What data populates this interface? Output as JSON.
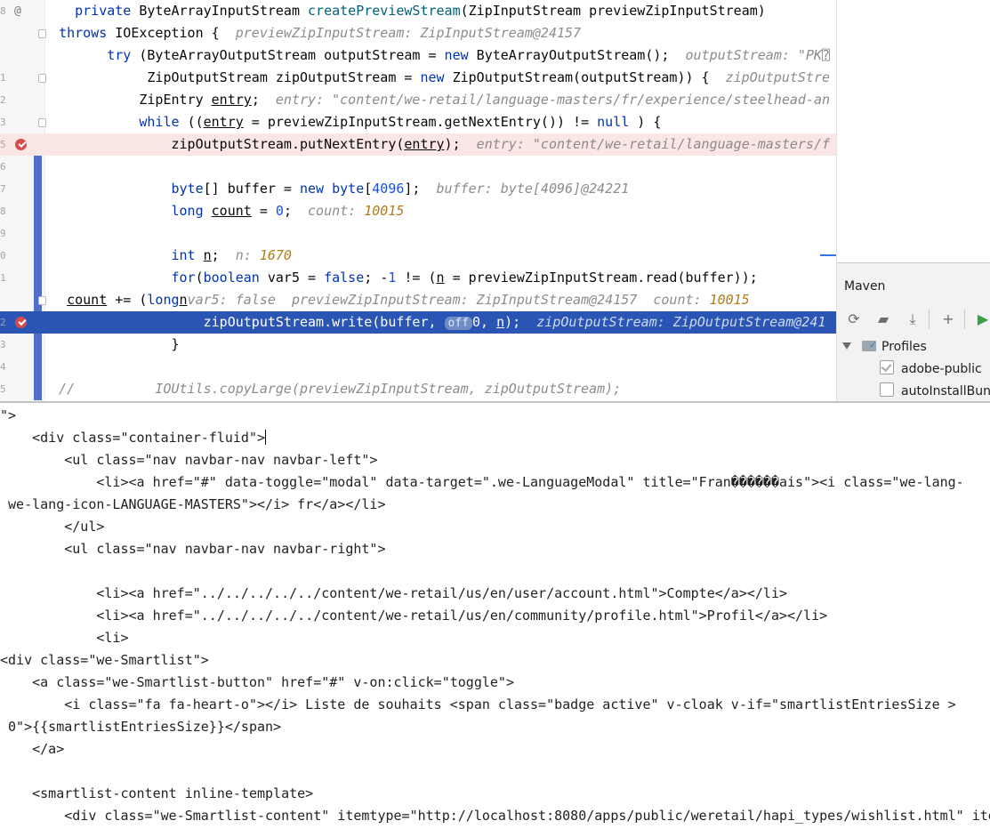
{
  "editor": {
    "lines": [
      {
        "id": "l0",
        "gutter": "8",
        "gutter_icon": "at-icon",
        "parts": [
          [
            "",
            "    "
          ],
          [
            "kw",
            "private "
          ],
          [
            "",
            "ByteArrayInputStream "
          ],
          [
            "fn",
            "createPreviewStream"
          ],
          [
            "",
            "(ZipInputStream previewZipInputStream)"
          ]
        ]
      },
      {
        "id": "l1",
        "gutter": "",
        "fold": true,
        "parts": [
          [
            "",
            "  "
          ],
          [
            "kw",
            "throws "
          ],
          [
            "",
            "IOException {  "
          ],
          [
            "hint",
            "previewZipInputStream: ZipInputStream@24157"
          ]
        ]
      },
      {
        "id": "l2",
        "gutter": "",
        "parts": [
          [
            "",
            "        "
          ],
          [
            "kw",
            "try "
          ],
          [
            "",
            "(ByteArrayOutputStream outputStream = "
          ],
          [
            "kw",
            "new "
          ],
          [
            "",
            "ByteArrayOutputStream();  "
          ],
          [
            "hint",
            "outputStream: "
          ],
          [
            "hint hstr",
            "\"PK⍰"
          ]
        ]
      },
      {
        "id": "l3",
        "gutter": "1",
        "fold": true,
        "parts": [
          [
            "",
            "             ZipOutputStream zipOutputStream = "
          ],
          [
            "kw",
            "new "
          ],
          [
            "",
            "ZipOutputStream(outputStream)) {  "
          ],
          [
            "hint",
            "zipOutputStre"
          ]
        ]
      },
      {
        "id": "l4",
        "gutter": "2",
        "parts": [
          [
            "",
            "            ZipEntry "
          ],
          [
            "ul",
            "entry"
          ],
          [
            "",
            ";  "
          ],
          [
            "hint",
            "entry: "
          ],
          [
            "hint hstr",
            "\"content/we-retail/language-masters/fr/experience/steelhead-an"
          ]
        ]
      },
      {
        "id": "l5",
        "gutter": "3",
        "fold": true,
        "parts": [
          [
            "",
            "            "
          ],
          [
            "kw",
            "while "
          ],
          [
            "",
            "(("
          ],
          [
            "ul",
            "entry"
          ],
          [
            "",
            " = previewZipInputStream.getNextEntry()) != "
          ],
          [
            "kw",
            "null"
          ],
          [
            "",
            " ) {"
          ]
        ]
      },
      {
        "id": "l6",
        "gutter": "5",
        "breakpoint": true,
        "bg": "bp",
        "parts": [
          [
            "",
            "                zipOutputStream.putNextEntry("
          ],
          [
            "ul",
            "entry"
          ],
          [
            "",
            ");  "
          ],
          [
            "hint",
            "entry: "
          ],
          [
            "hint hstr",
            "\"content/we-retail/language-masters/f"
          ]
        ]
      },
      {
        "id": "l7",
        "gutter": "6",
        "parts": []
      },
      {
        "id": "l8",
        "gutter": "7",
        "parts": [
          [
            "",
            "                "
          ],
          [
            "kw",
            "byte"
          ],
          [
            "",
            "[] buffer = "
          ],
          [
            "kw",
            "new byte"
          ],
          [
            "",
            "["
          ],
          [
            "num",
            "4096"
          ],
          [
            "",
            "];  "
          ],
          [
            "hint",
            "buffer: byte[4096]@24221"
          ]
        ]
      },
      {
        "id": "l9",
        "gutter": "8",
        "parts": [
          [
            "",
            "                "
          ],
          [
            "kw",
            "long "
          ],
          [
            "ul",
            "count"
          ],
          [
            "",
            " = "
          ],
          [
            "num",
            "0"
          ],
          [
            "",
            ";  "
          ],
          [
            "hint",
            "count: "
          ],
          [
            "hint hnum",
            "10015"
          ]
        ]
      },
      {
        "id": "l10",
        "gutter": "9",
        "parts": []
      },
      {
        "id": "l11",
        "gutter": "0",
        "parts": [
          [
            "",
            "                "
          ],
          [
            "kw",
            "int "
          ],
          [
            "ul",
            "n"
          ],
          [
            "",
            ";  "
          ],
          [
            "hint",
            "n: "
          ],
          [
            "hint hnum",
            "1670"
          ]
        ]
      },
      {
        "id": "l12",
        "gutter": "1",
        "parts": [
          [
            "",
            "                "
          ],
          [
            "kw",
            "for"
          ],
          [
            "",
            "("
          ],
          [
            "kw",
            "boolean "
          ],
          [
            "",
            "var5 = "
          ],
          [
            "kw",
            "false"
          ],
          [
            "",
            "; -"
          ],
          [
            "num",
            "1"
          ],
          [
            "",
            " != ("
          ],
          [
            "ul",
            "n"
          ],
          [
            "",
            " = previewZipInputStream.read(buffer));"
          ]
        ]
      },
      {
        "id": "l13",
        "gutter": "",
        "fold": true,
        "parts": [
          [
            "",
            "   "
          ],
          [
            "ul",
            "count"
          ],
          [
            "",
            " += ("
          ],
          [
            "kw",
            "long"
          ],
          [
            ")"
          ],
          [
            "ul",
            "n"
          ],
          [
            ") {  "
          ],
          [
            "hint",
            "var5: false  previewZipInputStream: ZipInputStream@24157  count: "
          ],
          [
            "hint hnum",
            "10015"
          ]
        ]
      },
      {
        "id": "l14",
        "gutter": "2",
        "breakpoint": true,
        "bg": "cur",
        "parts": [
          [
            "",
            "                    zipOutputStream.write(buffer, "
          ],
          [
            "off-chip",
            "off"
          ],
          [
            "",
            "0, "
          ],
          [
            "ul",
            "n"
          ],
          [
            "",
            ");  "
          ],
          [
            "hint",
            "zipOutputStream: ZipOutputStream@241"
          ]
        ]
      },
      {
        "id": "l15",
        "gutter": "3",
        "parts": [
          [
            "",
            "                }"
          ]
        ]
      },
      {
        "id": "l16",
        "gutter": "4",
        "parts": []
      },
      {
        "id": "l17",
        "gutter": "5",
        "parts": [
          [
            "cmt",
            "  //          IOUtils.copyLarge(previewZipInputStream, zipOutputStream);"
          ]
        ]
      }
    ]
  },
  "maven": {
    "title": "Maven",
    "tools": [
      "refresh-icon",
      "reimport-folder-icon",
      "download-icon",
      "add-icon",
      "run-icon"
    ],
    "profiles_label": "Profiles",
    "profiles": [
      {
        "name": "adobe-public",
        "checked": true
      },
      {
        "name": "autoInstallBunc",
        "checked": false
      }
    ]
  },
  "source": {
    "lines": [
      "\">",
      "    <div class=\"container-fluid\">",
      "        <ul class=\"nav navbar-nav navbar-left\">",
      "            <li><a href=\"#\" data-toggle=\"modal\" data-target=\".we-LanguageModal\" title=\"Fran������ais\"><i class=\"we-lang-",
      " we-lang-icon-LANGUAGE-MASTERS\"></i> fr</a></li>",
      "        </ul>",
      "        <ul class=\"nav navbar-nav navbar-right\">",
      "",
      "            <li><a href=\"../../../../../content/we-retail/us/en/user/account.html\">Compte</a></li>",
      "            <li><a href=\"../../../../../content/we-retail/us/en/community/profile.html\">Profil</a></li>",
      "            <li>",
      "<div class=\"we-Smartlist\">",
      "    <a class=\"we-Smartlist-button\" href=\"#\" v-on:click=\"toggle\">",
      "        <i class=\"fa fa-heart-o\"></i> Liste de souhaits <span class=\"badge active\" v-cloak v-if=\"smartlistEntriesSize >",
      " 0\">{{smartlistEntriesSize}}</span>",
      "    </a>",
      "",
      "    <smartlist-content inline-template>",
      "        <div class=\"we-Smartlist-content\" itemtype=\"http://localhost:8080/apps/public/weretail/hapi_types/wishlist.html\" ite"
    ]
  }
}
